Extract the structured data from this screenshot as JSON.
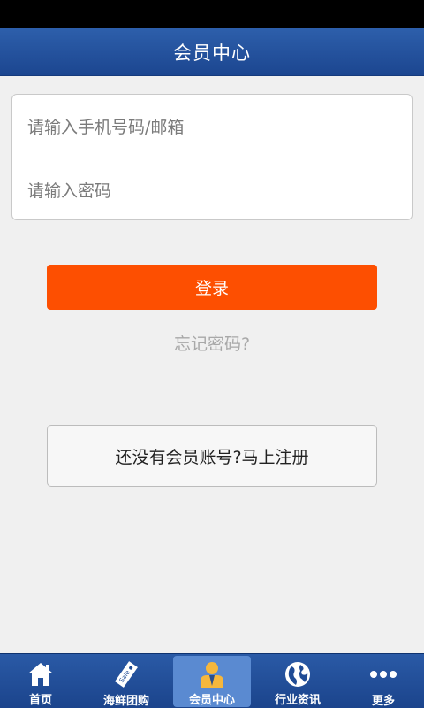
{
  "header": {
    "title": "会员中心"
  },
  "login_form": {
    "account_placeholder": "请输入手机号码/邮箱",
    "password_placeholder": "请输入密码",
    "login_label": "登录",
    "forgot_password_label": "忘记密码?"
  },
  "register": {
    "label": "还没有会员账号?马上注册"
  },
  "tabs": [
    {
      "label": "首页",
      "icon": "home-icon",
      "active": false
    },
    {
      "label": "海鲜团购",
      "icon": "sale-tag-icon",
      "active": false
    },
    {
      "label": "会员中心",
      "icon": "member-icon",
      "active": true
    },
    {
      "label": "行业资讯",
      "icon": "globe-icon",
      "active": false
    },
    {
      "label": "更多",
      "icon": "more-icon",
      "active": false
    }
  ],
  "colors": {
    "header_bg": "#1c4690",
    "accent": "#fd4f01",
    "page_bg": "#f0f0f0",
    "tab_active_bg": "#5a8ad1"
  }
}
